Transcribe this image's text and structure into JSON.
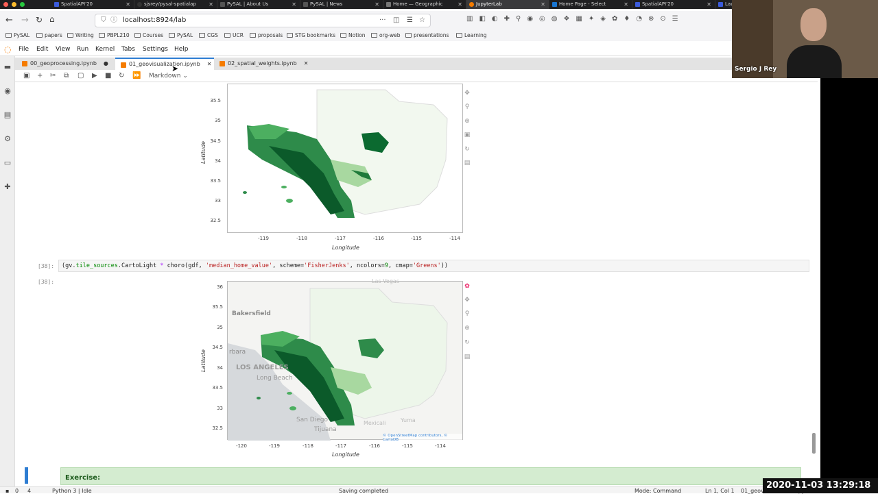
{
  "browser": {
    "tabs": [
      {
        "label": "SpatialAPI'20",
        "color": "#3b5bdb"
      },
      {
        "label": "sjsrey/pysal-spatialap",
        "color": "#333"
      },
      {
        "label": "PySAL | About Us",
        "color": "#555"
      },
      {
        "label": "PySAL | News",
        "color": "#555"
      },
      {
        "label": "Home — Geographic",
        "color": "#777"
      },
      {
        "label": "JupyterLab",
        "color": "#f57c00"
      },
      {
        "label": "Home Page - Select",
        "color": "#1976d2"
      },
      {
        "label": "SpatialAPI'20",
        "color": "#3b5bdb"
      },
      {
        "label": "Launc",
        "color": "#3b5bdb"
      }
    ],
    "url": "localhost:8924/lab",
    "bookmarks": [
      "PySAL",
      "papers",
      "Writing",
      "PBPL210",
      "Courses",
      "PySAL",
      "CGS",
      "UCR",
      "proposals",
      "STG bookmarks",
      "Notion",
      "org-web",
      "presentations",
      "Learning"
    ]
  },
  "menu": [
    "File",
    "Edit",
    "View",
    "Run",
    "Kernel",
    "Tabs",
    "Settings",
    "Help"
  ],
  "doc_tabs": [
    {
      "label": "00_geoprocessing.ipynb",
      "modified": "●"
    },
    {
      "label": "01_geovisualization.ipynb",
      "modified": "✕"
    },
    {
      "label": "02_spatial_weights.ipynb",
      "modified": "✕"
    }
  ],
  "toolbar": {
    "cell_type": "Markdown"
  },
  "plot1": {
    "ylabel": "Latitude",
    "xlabel": "Longitude",
    "yticks": [
      "35.5",
      "35",
      "34.5",
      "34",
      "33.5",
      "33",
      "32.5"
    ],
    "xticks": [
      "-119",
      "-118",
      "-117",
      "-116",
      "-115",
      "-114"
    ]
  },
  "cell38": {
    "in_prompt": "[38]:",
    "out_prompt": "[38]:",
    "code": {
      "a": "(gv.",
      "b": "tile_sources",
      "c": ".CartoLight ",
      "d": "*",
      "e": " choro(gdf, ",
      "f": "'median_home_value'",
      "g": ", scheme=",
      "h": "'FisherJenks'",
      "i": ", ncolors=",
      "j": "9",
      "k": ", cmap=",
      "l": "'Greens'",
      "m": "))"
    }
  },
  "plot2": {
    "ylabel": "Latitude",
    "xlabel": "Longitude",
    "yticks": [
      "36",
      "35.5",
      "35",
      "34.5",
      "34",
      "33.5",
      "33",
      "32.5"
    ],
    "xticks": [
      "-120",
      "-119",
      "-118",
      "-117",
      "-116",
      "-115",
      "-114"
    ],
    "places": [
      "Bakersfield",
      "rbara",
      "LOS ANGELES",
      "Long Beach",
      "San Diego",
      "Tijuana",
      "Mexicali",
      "Yuma",
      "Las Vegas"
    ],
    "attribution": "© OpenStreetMap contributors, © CartoDB"
  },
  "exercise": "Exercise:",
  "status": {
    "left_a": "0",
    "left_b": "4",
    "kernel": "Python 3 | Idle",
    "saving": "Saving completed",
    "mode": "Mode: Command",
    "pos": "Ln 1, Col 1",
    "file": "01_geovisualization.ipynb"
  },
  "video": {
    "name": "Sergio J Rey"
  },
  "timestamp": "2020-11-03  13:29:18",
  "colors": {
    "accent": "#2e7dd2",
    "green_dark": "#00692e",
    "green_light": "#c7e9c0"
  }
}
